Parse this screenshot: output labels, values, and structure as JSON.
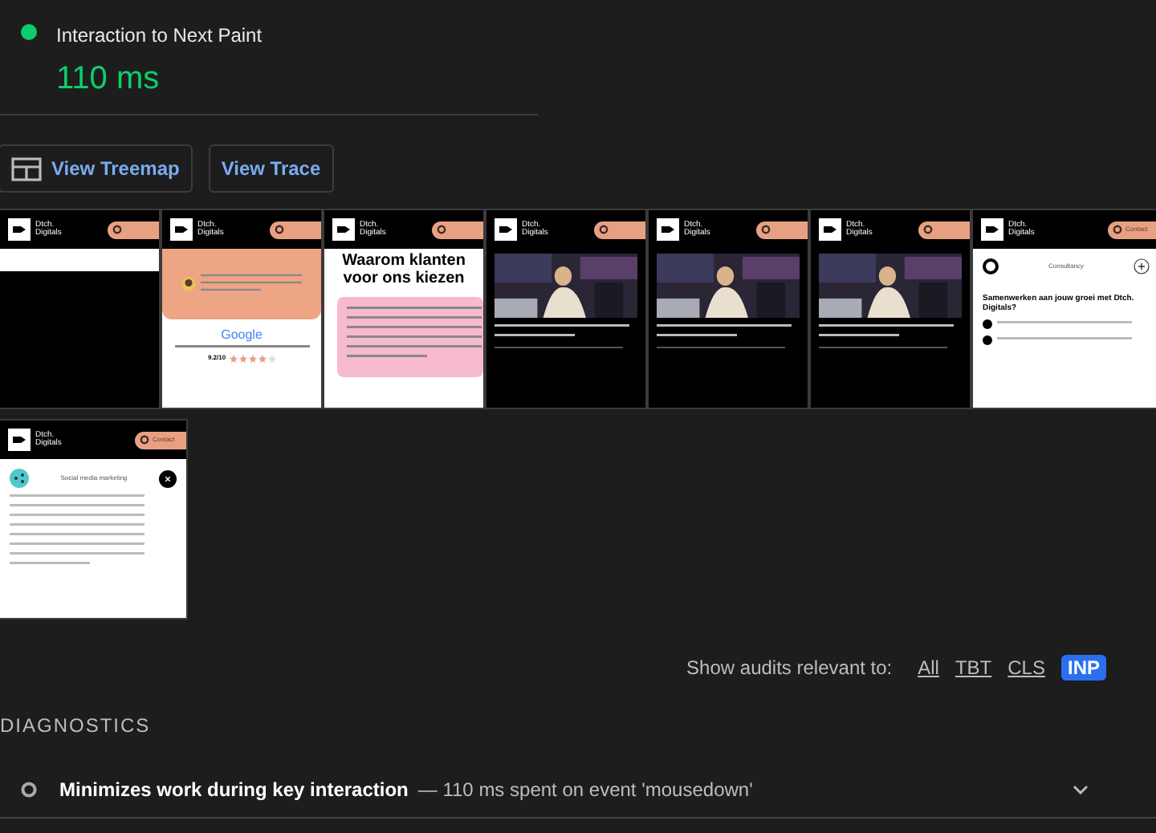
{
  "metric": {
    "label": "Interaction to Next Paint",
    "value": "110 ms",
    "color": "#0cce6b"
  },
  "buttons": [
    {
      "label": "View Treemap",
      "icon": true
    },
    {
      "label": "View Trace",
      "icon": false
    }
  ],
  "filmstrip": [
    {
      "kind": "blank",
      "logo": "Dtch.\nDigitals"
    },
    {
      "kind": "review",
      "logo": "Dtch.\nDigitals",
      "brand": "Google",
      "score": "9.2/10",
      "stars": 4
    },
    {
      "kind": "heading",
      "logo": "Dtch.\nDigitals",
      "heading": "Waarom klanten voor ons kiezen"
    },
    {
      "kind": "video",
      "logo": "Dtch.\nDigitals"
    },
    {
      "kind": "video",
      "logo": "Dtch.\nDigitals"
    },
    {
      "kind": "video",
      "logo": "Dtch.\nDigitals"
    },
    {
      "kind": "services",
      "logo": "Dtch.\nDigitals",
      "contact": "Contact",
      "service": "Consultancy",
      "heading": "Samenwerken aan jouw groei met Dtch. Digitals?"
    },
    {
      "kind": "detail",
      "logo": "Dtch.\nDigitals",
      "contact": "Contact",
      "service": "Social media marketing"
    }
  ],
  "filter": {
    "label": "Show audits relevant to:",
    "options": [
      {
        "label": "All",
        "selected": false
      },
      {
        "label": "TBT",
        "selected": false
      },
      {
        "label": "CLS",
        "selected": false
      },
      {
        "label": "INP",
        "selected": true
      }
    ]
  },
  "section": "DIAGNOSTICS",
  "audits": [
    {
      "title": "Minimizes work during key interaction",
      "detail": "— 110 ms spent on event 'mousedown'",
      "expanded": false
    }
  ]
}
